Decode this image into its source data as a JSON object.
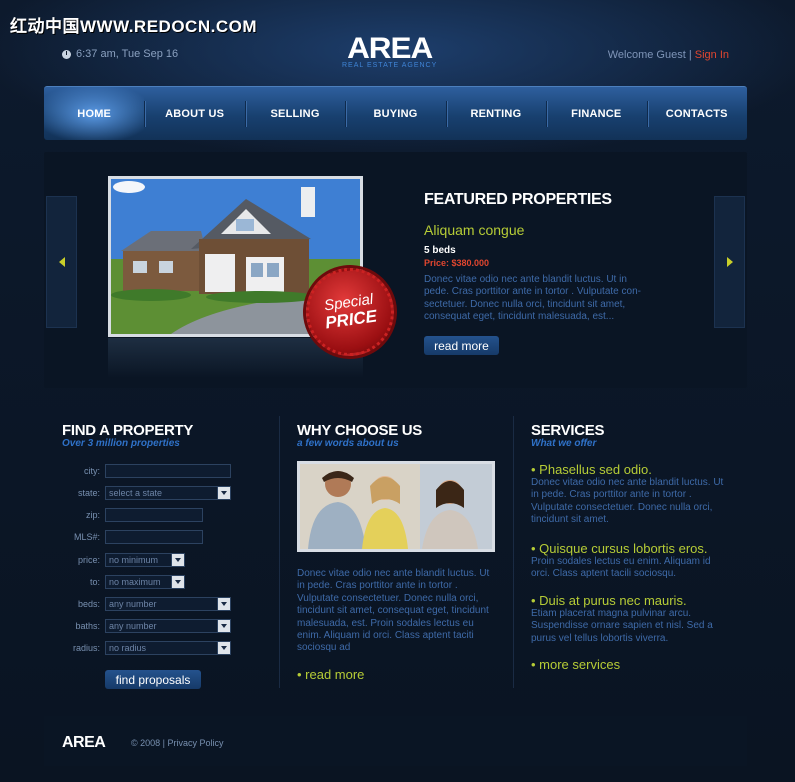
{
  "watermark": "红动中国WWW.REDOCN.COM",
  "header": {
    "time": "6:37 am, Tue Sep 16",
    "logo": "AREA",
    "logo_sub": "REAL ESTATE AGENCY",
    "welcome": "Welcome Guest |",
    "signin": "Sign In"
  },
  "nav": [
    "HOME",
    "ABOUT US",
    "SELLING",
    "BUYING",
    "RENTING",
    "FINANCE",
    "CONTACTS"
  ],
  "featured": {
    "title": "FEATURED PROPERTIES",
    "name": "Aliquam congue",
    "beds": "5 beds",
    "price": "Price: $380.000",
    "text": "Donec vitae odio nec ante blandit luctus. Ut in pede. Cras porttitor ante in tortor . Vulputate con-sectetuer. Donec nulla orci, tincidunt sit amet, consequat eget, tincidunt malesuada, est...",
    "read_more": "read more",
    "badge_top": "Special",
    "badge_bottom": "PRICE"
  },
  "find": {
    "title": "FIND A PROPERTY",
    "subtitle": "Over 3 million properties",
    "labels": {
      "city": "city:",
      "state": "state:",
      "zip": "zip:",
      "mls": "MLS#:",
      "price": "price:",
      "to": "to:",
      "beds": "beds:",
      "baths": "baths:",
      "radius": "radius:"
    },
    "values": {
      "state": "select a state",
      "price": "no minimum",
      "to": "no maximum",
      "beds": "any number",
      "baths": "any number",
      "radius": "no radius"
    },
    "button": "find proposals"
  },
  "why": {
    "title": "WHY CHOOSE US",
    "subtitle": "a few words about us",
    "text": "Donec vitae odio nec ante blandit luctus. Ut in pede. Cras porttitor ante in tortor . Vulputate consectetuer. Donec nulla orci, tincidunt sit amet, consequat eget, tincidunt malesuada, est. Proin sodales lectus eu enim. Aliquam id orci. Class aptent taciti sociosqu ad",
    "read_more": "• read more"
  },
  "services": {
    "title": "SERVICES",
    "subtitle": "What we offer",
    "items": [
      {
        "heading": "• Phasellus sed odio.",
        "text": "Donec vitae odio nec ante blandit luctus. Ut in pede. Cras porttitor ante in tortor . Vulputate consectetuer. Donec nulla orci, tincidunt sit amet."
      },
      {
        "heading": "• Quisque cursus lobortis eros.",
        "text": "Proin sodales lectus eu enim. Aliquam id orci. Class aptent tacili sociosqu."
      },
      {
        "heading": "• Duis at purus nec mauris.",
        "text": "Etiam placerat magna pulvinar arcu. Suspendisse ornare sapien et nisl. Sed a purus vel tellus lobortis viverra."
      }
    ],
    "more": "• more services"
  },
  "footer": {
    "logo": "AREA",
    "copyright": "© 2008 | Privacy Policy"
  }
}
